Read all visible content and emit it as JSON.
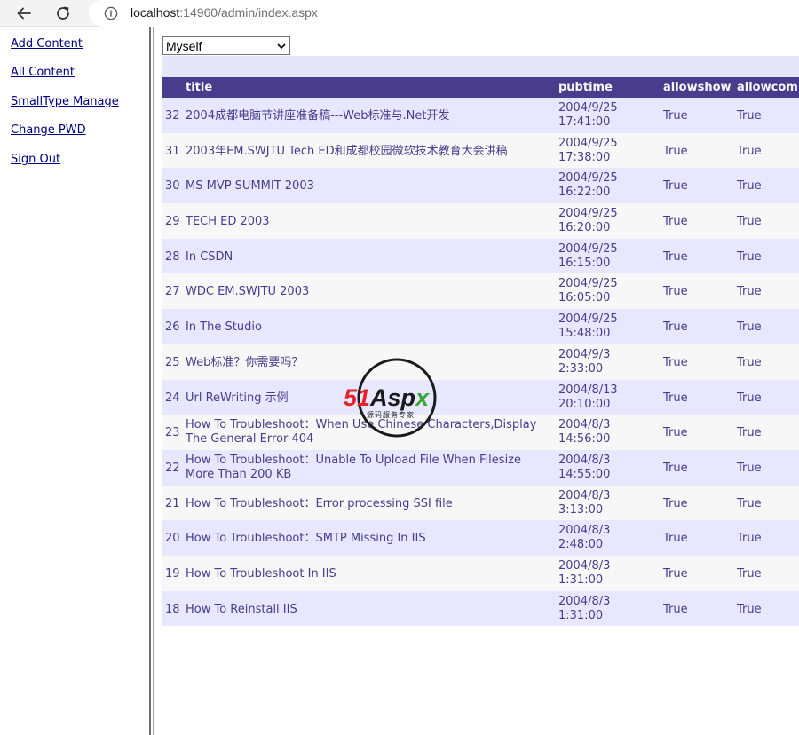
{
  "browser": {
    "url_host": "localhost",
    "url_rest": ":14960/admin/index.aspx"
  },
  "menu": {
    "items": [
      {
        "label": "Add Content"
      },
      {
        "label": "All Content"
      },
      {
        "label": "SmallType Manage"
      },
      {
        "label": "Change PWD"
      },
      {
        "label": "Sign Out"
      }
    ]
  },
  "filter": {
    "selected": "Myself"
  },
  "table": {
    "headers": {
      "title": "title",
      "pubtime": "pubtime",
      "allowshow": "allowshow",
      "allowcomment": "allowcom"
    },
    "rows": [
      {
        "id": "32",
        "title": "2004成都电脑节讲座准备稿---Web标准与.Net开发",
        "date": "2004/9/25",
        "time": "17:41:00",
        "allowshow": "True",
        "allowcomment": "True"
      },
      {
        "id": "31",
        "title": "2003年EM.SWJTU Tech ED和成都校园微软技术教育大会讲稿",
        "date": "2004/9/25",
        "time": "17:38:00",
        "allowshow": "True",
        "allowcomment": "True"
      },
      {
        "id": "30",
        "title": "MS MVP SUMMIT 2003",
        "date": "2004/9/25",
        "time": "16:22:00",
        "allowshow": "True",
        "allowcomment": "True"
      },
      {
        "id": "29",
        "title": "TECH ED 2003",
        "date": "2004/9/25",
        "time": "16:20:00",
        "allowshow": "True",
        "allowcomment": "True"
      },
      {
        "id": "28",
        "title": "In CSDN",
        "date": "2004/9/25",
        "time": "16:15:00",
        "allowshow": "True",
        "allowcomment": "True"
      },
      {
        "id": "27",
        "title": "WDC EM.SWJTU 2003",
        "date": "2004/9/25",
        "time": "16:05:00",
        "allowshow": "True",
        "allowcomment": "True"
      },
      {
        "id": "26",
        "title": "In The Studio",
        "date": "2004/9/25",
        "time": "15:48:00",
        "allowshow": "True",
        "allowcomment": "True"
      },
      {
        "id": "25",
        "title": "Web标准？你需要吗？",
        "date": "2004/9/3",
        "time": "2:33:00",
        "allowshow": "True",
        "allowcomment": "True"
      },
      {
        "id": "24",
        "title": "Url ReWriting 示例",
        "date": "2004/8/13",
        "time": "20:10:00",
        "allowshow": "True",
        "allowcomment": "True"
      },
      {
        "id": "23",
        "title": "How To Troubleshoot：When Use Chinese Characters,Display The General Error 404",
        "date": "2004/8/3",
        "time": "14:56:00",
        "allowshow": "True",
        "allowcomment": "True"
      },
      {
        "id": "22",
        "title": "How To Troubleshoot：Unable To Upload File When Filesize More Than 200 KB",
        "date": "2004/8/3",
        "time": "14:55:00",
        "allowshow": "True",
        "allowcomment": "True"
      },
      {
        "id": "21",
        "title": "How To Troubleshoot：Error processing SSI file",
        "date": "2004/8/3",
        "time": "3:13:00",
        "allowshow": "True",
        "allowcomment": "True"
      },
      {
        "id": "20",
        "title": "How To Troubleshoot：SMTP Missing In IIS",
        "date": "2004/8/3",
        "time": "2:48:00",
        "allowshow": "True",
        "allowcomment": "True"
      },
      {
        "id": "19",
        "title": "How To Troubleshoot In IIS",
        "date": "2004/8/3",
        "time": "1:31:00",
        "allowshow": "True",
        "allowcomment": "True"
      },
      {
        "id": "18",
        "title": "How To Reinstall IIS",
        "date": "2004/8/3",
        "time": "1:31:00",
        "allowshow": "True",
        "allowcomment": "True"
      }
    ]
  },
  "watermark": {
    "brand": "51Aspx",
    "tagline": "源码服务专家"
  },
  "colors": {
    "header_bg": "#4a3c8c",
    "row_odd": "#e7e7ff",
    "row_even": "#f7f7f7",
    "link": "#000080",
    "watermark_red": "#e0262b",
    "watermark_green": "#3aa53a"
  }
}
